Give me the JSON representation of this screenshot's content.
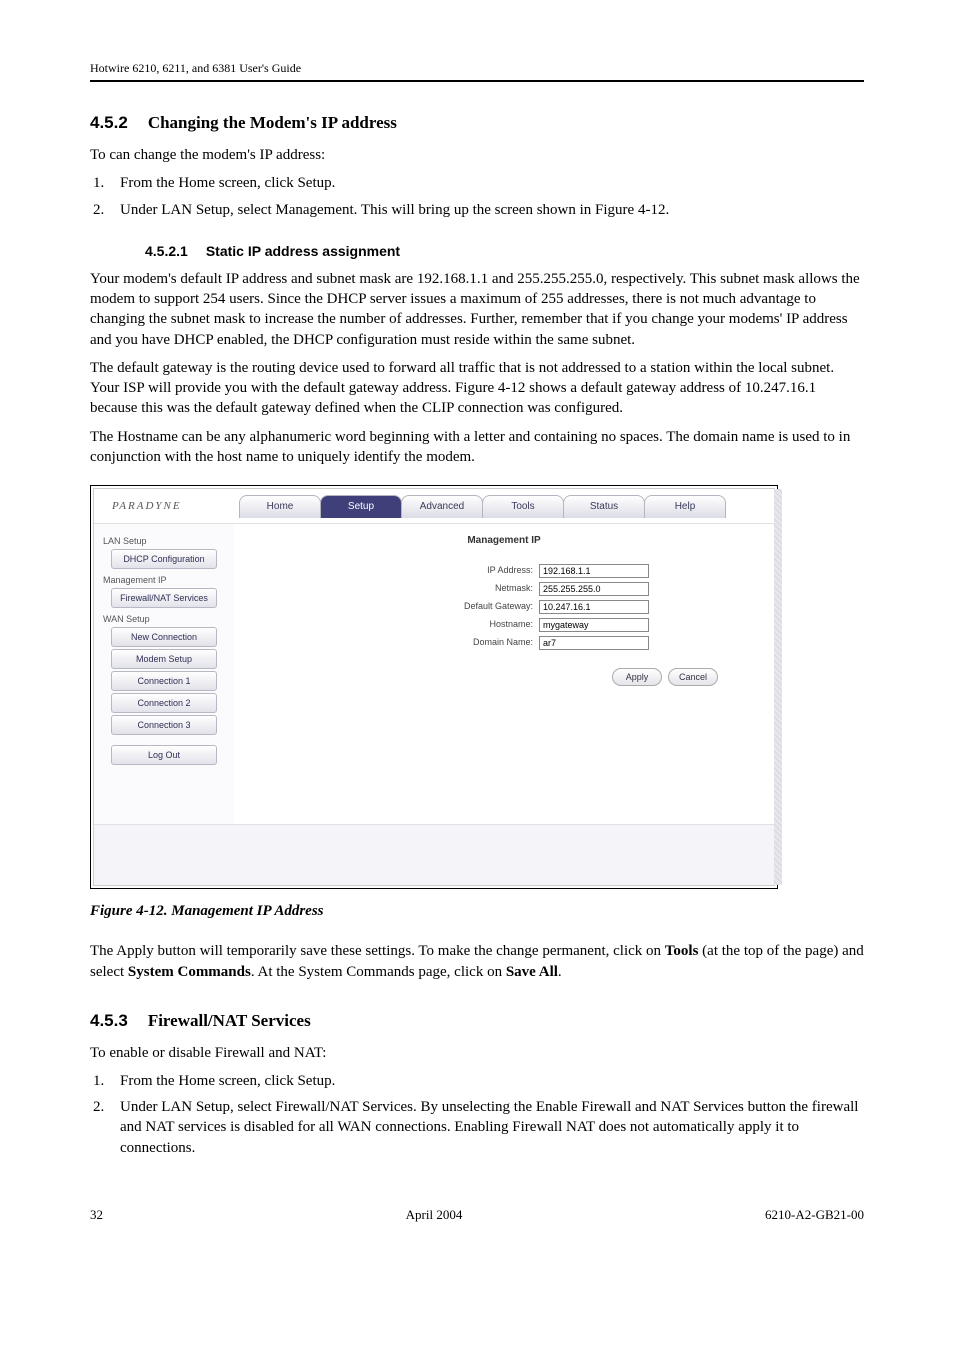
{
  "doc": {
    "header": "Hotwire 6210, 6211, and 6381 User's Guide",
    "s452": {
      "num": "4.5.2",
      "title": "Changing the Modem's IP address",
      "intro": "To can change the modem's IP address:",
      "step1": "From the Home screen, click Setup.",
      "step2": "Under LAN Setup, select Management. This will bring up the screen shown in Figure 4-12."
    },
    "s4521": {
      "num": "4.5.2.1",
      "title": "Static IP address assignment",
      "p1": "Your modem's default IP address and subnet mask are 192.168.1.1 and 255.255.255.0, respectively. This subnet mask allows the modem to support 254 users. Since the DHCP server issues a maximum of 255 addresses, there is not much advantage to changing the subnet mask to increase the number of addresses. Further, remember that if you change your modems' IP address and you have DHCP enabled, the DHCP configuration must reside within the same subnet.",
      "p2": " The default gateway is the routing device used to forward all traffic that is not addressed to a station within the local subnet. Your ISP will provide you with the default gateway address. Figure 4-12 shows a default gateway address of 10.247.16.1 because this was the default gateway defined when the CLIP connection was configured.",
      "p3": "The Hostname can be any alphanumeric word beginning with a letter and containing no spaces. The domain name is used to in conjunction with the host name to uniquely identify the modem."
    },
    "fig": {
      "caption": "Figure 4-12. Management IP Address"
    },
    "after_pre": "The Apply button will temporarily save these settings. To make the change permanent, click on ",
    "after_b1": "Tools",
    "after_mid": " (at the top of the page) and select ",
    "after_b2": "System Commands",
    "after_mid2": ". At the System Commands page, click on ",
    "after_b3": "Save All",
    "after_post": ".",
    "s453": {
      "num": "4.5.3",
      "title": "Firewall/NAT Services",
      "intro": "To enable or disable Firewall and NAT:",
      "step1": "From the Home screen, click Setup.",
      "step2": "Under LAN Setup, select Firewall/NAT Services. By unselecting the Enable Firewall and NAT Services button the firewall and NAT services is disabled for all WAN connections.  Enabling Firewall NAT does not automatically apply it to connections."
    },
    "footer": {
      "left": "32",
      "center": "April 2004",
      "right": "6210-A2-GB21-00"
    }
  },
  "shot": {
    "logo": "PARADYNE",
    "tabs": [
      "Home",
      "Setup",
      "Advanced",
      "Tools",
      "Status",
      "Help"
    ],
    "active_tab_index": 1,
    "sidebar": {
      "label1": "LAN Setup",
      "b1": "DHCP Configuration",
      "l2": "Management IP",
      "b2": "Firewall/NAT Services",
      "label2": "WAN Setup",
      "b3": "New Connection",
      "b4": "Modem Setup",
      "b5": "Connection 1",
      "b6": "Connection 2",
      "b7": "Connection 3",
      "logout": "Log Out"
    },
    "pane": {
      "title": "Management IP",
      "rows": {
        "ip": {
          "label": "IP Address:",
          "value": "192.168.1.1"
        },
        "mask": {
          "label": "Netmask:",
          "value": "255.255.255.0"
        },
        "gw": {
          "label": "Default Gateway:",
          "value": "10.247.16.1"
        },
        "host": {
          "label": "Hostname:",
          "value": "mygateway"
        },
        "domain": {
          "label": "Domain Name:",
          "value": "ar7"
        }
      },
      "apply": "Apply",
      "cancel": "Cancel"
    }
  }
}
